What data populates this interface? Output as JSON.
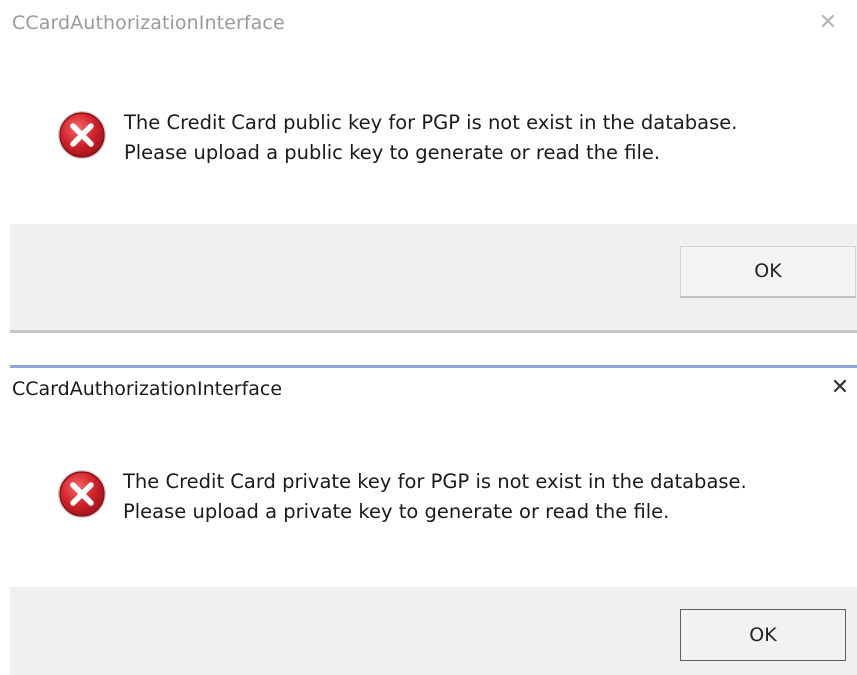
{
  "dialogs": [
    {
      "title": "CCardAuthorizationInterface",
      "close_glyph": "✕",
      "icon": "error-icon",
      "message_line1": "The Credit Card public key for PGP is not exist in the database.",
      "message_line2": "Please upload a public key to generate or read the file.",
      "ok_label": "OK",
      "active": false
    },
    {
      "title": "CCardAuthorizationInterface",
      "close_glyph": "✕",
      "icon": "error-icon",
      "message_line1": "The Credit Card private key for PGP is not exist in the database.",
      "message_line2": "Please upload a private key to generate or read the file.",
      "ok_label": "OK",
      "active": true
    }
  ],
  "colors": {
    "error_red": "#d4222b",
    "active_border": "#8ea6d8",
    "footer_bg": "#f0f0f0"
  }
}
